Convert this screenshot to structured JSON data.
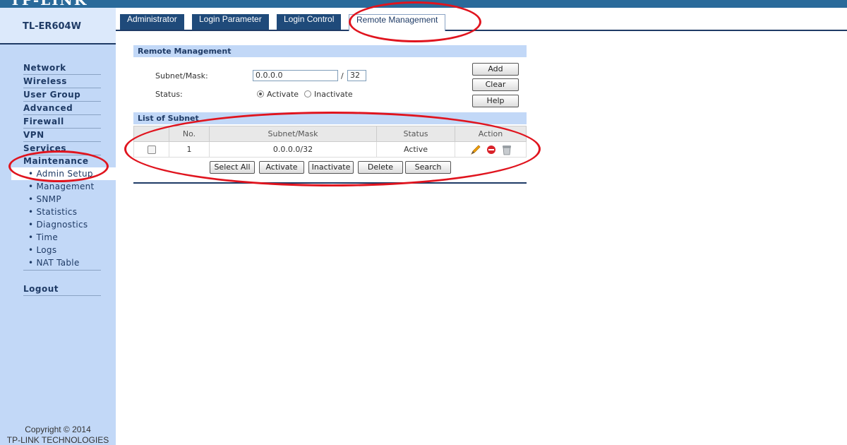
{
  "brand": {
    "fragment": "TP-LINK"
  },
  "sidebar": {
    "model": "TL-ER604W",
    "nav": [
      {
        "label": "Network"
      },
      {
        "label": "Wireless"
      },
      {
        "label": "User Group"
      },
      {
        "label": "Advanced"
      },
      {
        "label": "Firewall"
      },
      {
        "label": "VPN"
      },
      {
        "label": "Services"
      },
      {
        "label": "Maintenance"
      }
    ],
    "sub": [
      {
        "label": "• Admin Setup"
      },
      {
        "label": "• Management"
      },
      {
        "label": "• SNMP"
      },
      {
        "label": "• Statistics"
      },
      {
        "label": "• Diagnostics"
      },
      {
        "label": "• Time"
      },
      {
        "label": "• Logs"
      },
      {
        "label": "• NAT Table"
      }
    ],
    "logout": "Logout",
    "copyright_line1": "Copyright © 2014",
    "copyright_line2": "TP-LINK TECHNOLOGIES"
  },
  "tabs": [
    {
      "label": "Administrator"
    },
    {
      "label": "Login Parameter"
    },
    {
      "label": "Login Control"
    },
    {
      "label": "Remote Management"
    }
  ],
  "remote": {
    "title": "Remote Management",
    "subnet_label": "Subnet/Mask:",
    "subnet_value": "0.0.0.0",
    "slash": "/",
    "mask_value": "32",
    "status_label": "Status:",
    "activate": "Activate",
    "inactivate": "Inactivate",
    "add": "Add",
    "clear": "Clear",
    "help": "Help"
  },
  "list": {
    "title": "List of Subnet",
    "headers": [
      "No.",
      "Subnet/Mask",
      "Status",
      "Action"
    ],
    "rows": [
      {
        "no": "1",
        "subnet": "0.0.0.0/32",
        "status": "Active"
      }
    ],
    "buttons": [
      "Select All",
      "Activate",
      "Inactivate",
      "Delete",
      "Search"
    ]
  },
  "colors": {
    "accent": "#1f3b66",
    "sidebar": "#c2d8f7",
    "annotation": "#e0141e"
  }
}
